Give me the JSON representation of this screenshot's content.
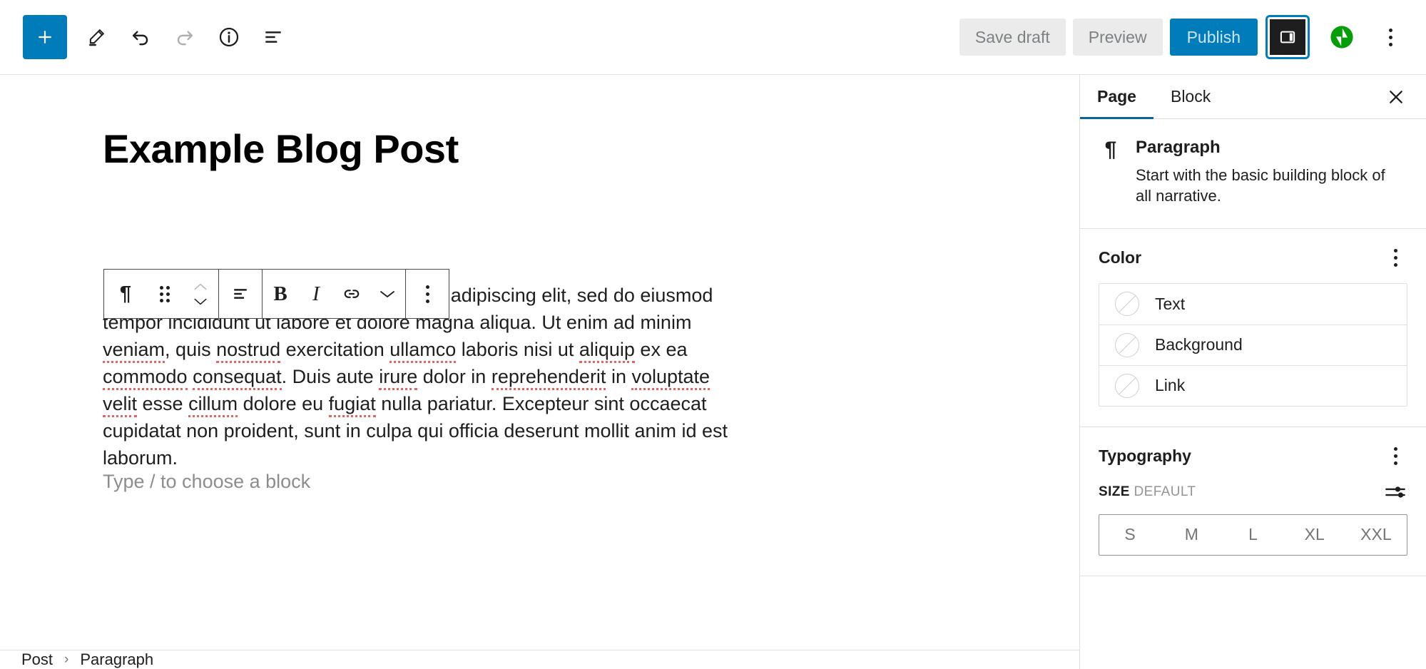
{
  "header": {
    "inserter_label": "Add block",
    "tools": [
      {
        "name": "edit-pencil-icon",
        "label": "Tools"
      },
      {
        "name": "undo-icon",
        "label": "Undo"
      },
      {
        "name": "redo-icon",
        "label": "Redo"
      },
      {
        "name": "info-icon",
        "label": "Details"
      },
      {
        "name": "list-view-icon",
        "label": "List view"
      }
    ],
    "save_draft_label": "Save draft",
    "preview_label": "Preview",
    "publish_label": "Publish",
    "settings_toggle_label": "Settings",
    "jetpack_label": "Jetpack",
    "more_options_label": "Options"
  },
  "block_toolbar": {
    "block_type_icon": "¶",
    "items": [
      {
        "name": "block-type-paragraph",
        "label": "Paragraph"
      },
      {
        "name": "drag-handle-icon",
        "label": "Drag"
      },
      {
        "name": "move-up-down-icon",
        "label": "Move up / Move down"
      },
      {
        "name": "align-text-icon",
        "label": "Align text"
      },
      {
        "name": "bold-button",
        "label": "B"
      },
      {
        "name": "italic-button",
        "label": "I"
      },
      {
        "name": "link-button",
        "label": "Link"
      },
      {
        "name": "more-rich-text-icon",
        "label": "More"
      },
      {
        "name": "block-options-icon",
        "label": "Options"
      }
    ]
  },
  "editor": {
    "title": "Example Blog Post",
    "paragraph": "Lorem ipsum dolor sit amet, consectetur adipiscing elit, sed do eiusmod tempor incididunt ut labore et dolore magna aliqua. Ut enim ad minim veniam, quis nostrud exercitation ullamco laboris nisi ut aliquip ex ea commodo consequat. Duis aute irure dolor in reprehenderit in voluptate velit esse cillum dolore eu fugiat nulla pariatur. Excepteur sint occaecat cupidatat non proident, sunt in culpa qui officia deserunt mollit anim id est laborum.",
    "placeholder": "Type / to choose a block",
    "misspelled_words": [
      "veniam",
      "nostrud",
      "ullamco",
      "aliquip",
      "commodo",
      "consequat",
      "irure",
      "reprehenderit",
      "voluptate",
      "velit",
      "cillum",
      "fugiat"
    ]
  },
  "breadcrumb": {
    "items": [
      "Post",
      "Paragraph"
    ],
    "separator": "›"
  },
  "sidebar": {
    "tabs": [
      {
        "label": "Page",
        "active": true
      },
      {
        "label": "Block",
        "active": false
      }
    ],
    "close_label": "Close settings",
    "block_card": {
      "icon": "¶",
      "title": "Paragraph",
      "description": "Start with the basic building block of all narrative."
    },
    "color_section": {
      "title": "Color",
      "options_label": "Color options",
      "rows": [
        {
          "label": "Text"
        },
        {
          "label": "Background"
        },
        {
          "label": "Link"
        }
      ]
    },
    "typography_section": {
      "title": "Typography",
      "options_label": "Typography options",
      "size_label": "SIZE",
      "size_value": "DEFAULT",
      "size_settings_label": "Set custom size",
      "sizes": [
        "S",
        "M",
        "L",
        "XL",
        "XXL"
      ]
    }
  },
  "colors": {
    "accent": "#007cba",
    "tab_underline": "#0b6695",
    "jetpack_green": "#069e08",
    "spellcheck_red": "#e06666",
    "button_bg": "#ebebeb",
    "text": "#1e1e1e"
  }
}
